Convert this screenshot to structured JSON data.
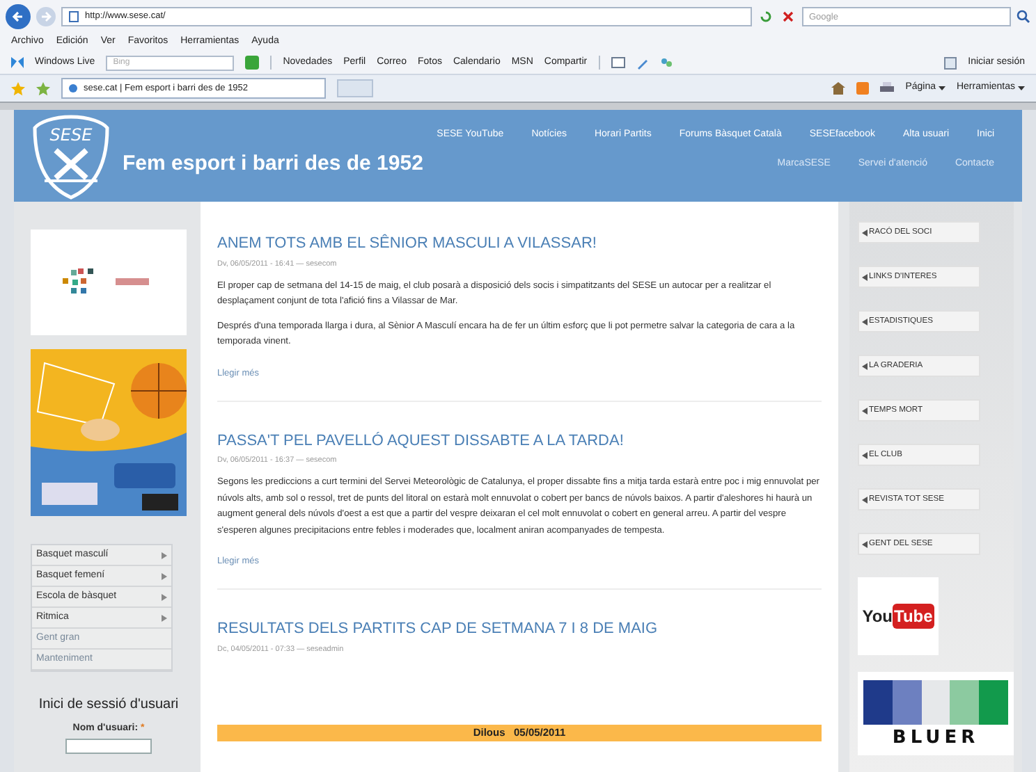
{
  "browser": {
    "address": "http://www.sese.cat/",
    "search_placeholder": "Google",
    "menu": [
      "Archivo",
      "Edición",
      "Ver",
      "Favoritos",
      "Herramientas",
      "Ayuda"
    ],
    "toolbar": {
      "brand": "Windows Live",
      "search_placeholder": "Bing",
      "links": [
        "Novedades",
        "Perfil",
        "Correo",
        "Fotos",
        "Calendario",
        "MSN",
        "Compartir"
      ],
      "signin": "Iniciar sesión"
    },
    "tab": {
      "title": "sese.cat | Fem esport i barri des de 1952"
    },
    "commands": [
      "Página",
      "Herramientas"
    ]
  },
  "header": {
    "logo_text": "SESE",
    "title": "Fem esport i barri des de 1952",
    "nav": [
      "SESE YouTube",
      "Notícies",
      "Horari Partits",
      "Forums Bàsquet Català",
      "SESEfacebook",
      "Alta usuari",
      "Inici"
    ],
    "subnav": [
      "MarcaSESE",
      "Servei d'atenció",
      "Contacte"
    ]
  },
  "left": {
    "menu": [
      {
        "label": "Basquet masculí",
        "has_submenu": true
      },
      {
        "label": "Basquet femení",
        "has_submenu": true
      },
      {
        "label": "Escola de bàsquet",
        "has_submenu": true
      },
      {
        "label": "Ritmica",
        "has_submenu": true
      },
      {
        "label": "Gent gran",
        "has_submenu": false
      },
      {
        "label": "Manteniment",
        "has_submenu": false
      }
    ],
    "login": {
      "heading": "Inici de sessió d'usuari",
      "username_label": "Nom d'usuari:",
      "required_mark": "*"
    }
  },
  "articles": [
    {
      "title": "ANEM TOTS AMB EL SÊNIOR MASCULI A VILASSAR!",
      "meta": "Dv, 06/05/2011 - 16:41 — sesecom",
      "paragraphs": [
        "El proper cap de setmana del 14-15 de maig, el club posarà a disposició dels socis i simpatitzants del SESE un autocar per a realitzar el desplaçament conjunt de tota l'afició fins a Vilassar de Mar.",
        "Després d'una temporada llarga i dura, al Sènior A Masculí encara ha de fer un últim esforç que li pot permetre salvar la categoria de cara a la temporada vinent."
      ],
      "read_more": "Llegir més"
    },
    {
      "title": "PASSA'T PEL PAVELLÓ AQUEST DISSABTE A LA TARDA!",
      "meta": "Dv, 06/05/2011 - 16:37 — sesecom",
      "paragraphs": [
        "Segons les prediccions a curt termini del Servei Meteorològic de Catalunya, el proper dissabte fins a mitja tarda estarà entre poc i mig ennuvolat per núvols alts, amb sol o ressol, tret de punts del litoral on estarà molt ennuvolat o cobert per bancs de núvols baixos. A partir d'aleshores hi haurà un augment general dels núvols d'oest a est que a partir del vespre deixaran el cel molt ennuvolat o cobert en general arreu. A partir del vespre s'esperen algunes precipitacions entre febles i moderades que, localment aniran acompanyades de tempesta."
      ],
      "read_more": "Llegir més"
    },
    {
      "title": "RESULTATS DELS PARTITS CAP DE SETMANA 7 I 8 DE MAIG",
      "meta": "Dc, 04/05/2011 - 07:33 — seseadmin"
    }
  ],
  "results_bar": {
    "text": "Dilous   05/05/2011"
  },
  "right": {
    "links": [
      "RACÓ DEL SOCI",
      "LINKS D'INTERES",
      "ESTADISTIQUES",
      "LA GRADERIA",
      "TEMPS MORT",
      "EL CLUB",
      "REVISTA TOT SESE",
      "GENT DEL SESE"
    ],
    "youtube": {
      "you": "You",
      "tube": "Tube"
    },
    "sponsor": "BLUER"
  }
}
